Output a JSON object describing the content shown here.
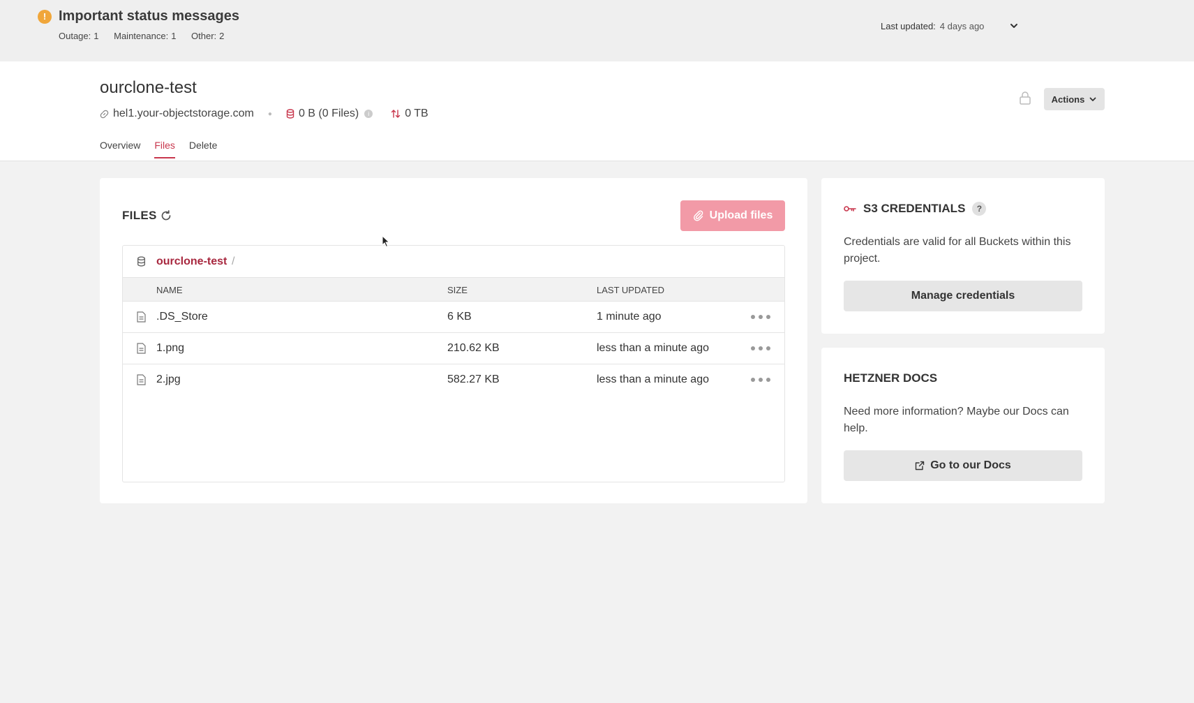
{
  "status": {
    "title": "Important status messages",
    "icon": "exclamation-circle-icon",
    "counts": [
      {
        "label": "Outage:",
        "value": "1"
      },
      {
        "label": "Maintenance:",
        "value": "1"
      },
      {
        "label": "Other:",
        "value": "2"
      }
    ],
    "last_updated_label": "Last updated:",
    "last_updated_value": "4 days ago"
  },
  "bucket": {
    "title": "ourclone-test",
    "endpoint": "hel1.your-objectstorage.com",
    "usage": "0 B (0 Files)",
    "traffic": "0 TB",
    "actions_label": "Actions"
  },
  "tabs": [
    {
      "label": "Overview",
      "active": false
    },
    {
      "label": "Files",
      "active": true
    },
    {
      "label": "Delete",
      "active": false
    }
  ],
  "files": {
    "title": "FILES",
    "upload_label": "Upload files",
    "breadcrumb": "ourclone-test",
    "breadcrumb_sep": "/",
    "columns": {
      "name": "NAME",
      "size": "SIZE",
      "updated": "LAST UPDATED"
    },
    "rows": [
      {
        "name": ".DS_Store",
        "size": "6 KB",
        "updated": "1 minute ago"
      },
      {
        "name": "1.png",
        "size": "210.62 KB",
        "updated": "less than a minute ago"
      },
      {
        "name": "2.jpg",
        "size": "582.27 KB",
        "updated": "less than a minute ago"
      }
    ]
  },
  "s3": {
    "title": "S3 CREDENTIALS",
    "help": "?",
    "text": "Credentials are valid for all Buckets within this project.",
    "button": "Manage credentials"
  },
  "docs": {
    "title": "HETZNER DOCS",
    "text": "Need more information? Maybe our Docs can help.",
    "button": "Go to our Docs"
  },
  "colors": {
    "accent": "#c8374d",
    "upload_bg": "#f29aa7",
    "warning": "#f0a63a"
  }
}
